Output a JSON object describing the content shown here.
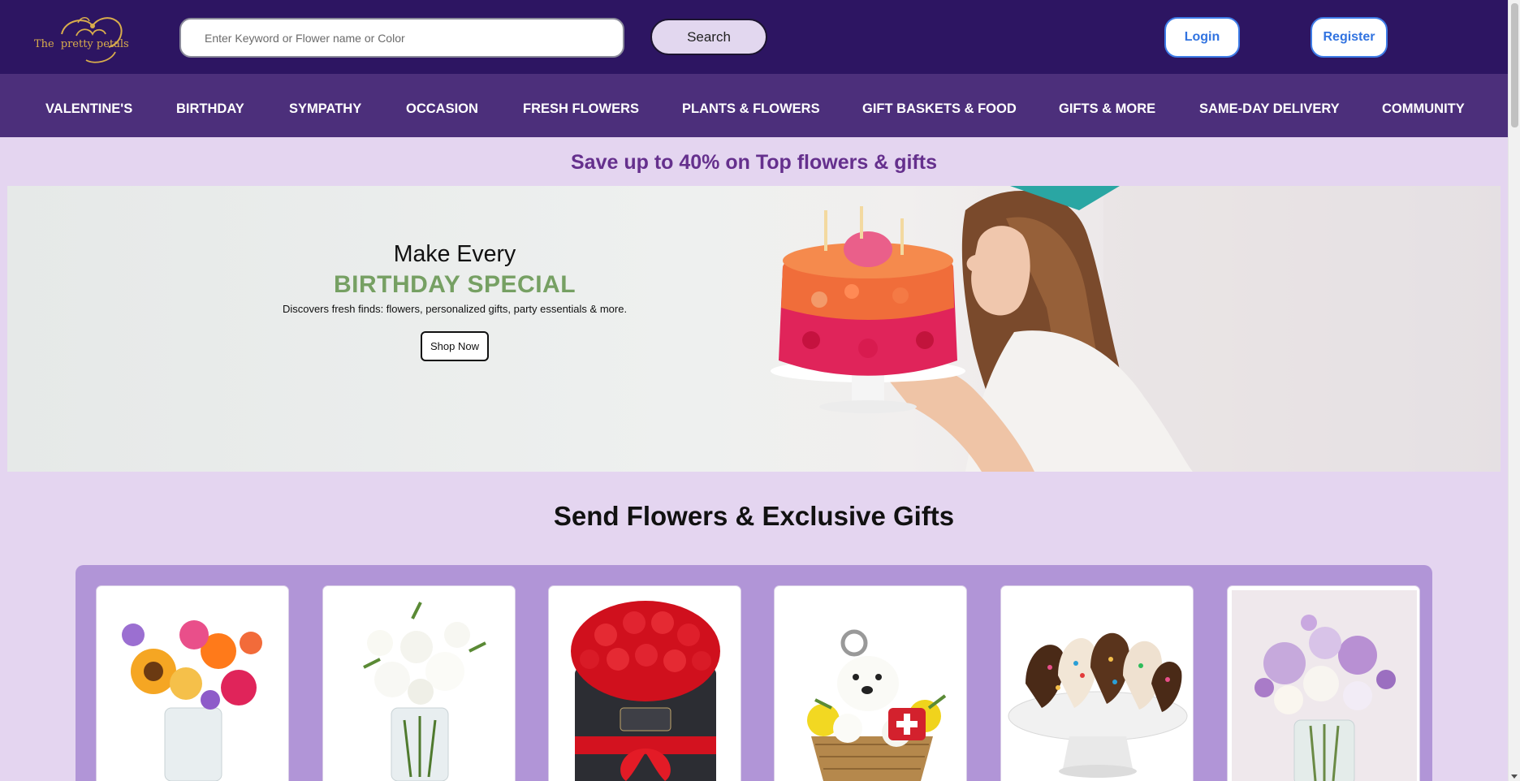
{
  "header": {
    "logo_text": [
      "The",
      "pretty petals"
    ],
    "search_placeholder": "Enter Keyword or Flower name or Color",
    "search_button": "Search",
    "login_button": "Login",
    "register_button": "Register"
  },
  "nav": {
    "items": [
      "VALENTINE'S",
      "BIRTHDAY",
      "SYMPATHY",
      "OCCASION",
      "FRESH FLOWERS",
      "PLANTS & FLOWERS",
      "GIFT BASKETS & FOOD",
      "GIFTS & MORE",
      "SAME-DAY DELIVERY",
      "COMMUNITY"
    ]
  },
  "promo": {
    "text": "Save up to 40% on Top flowers & gifts"
  },
  "hero": {
    "line1": "Make Every",
    "line2": "BIRTHDAY SPECIAL",
    "description": "Discovers fresh finds: flowers, personalized gifts, party essentials & more.",
    "cta": "Shop Now"
  },
  "section": {
    "title": "Send Flowers & Exclusive Gifts"
  },
  "products": [
    {
      "image": "mixed-bouquet-sunflowers-roses"
    },
    {
      "image": "white-lilies-roses-vase"
    },
    {
      "image": "red-roses-hat-box"
    },
    {
      "image": "get-well-puppy-flower-basket"
    },
    {
      "image": "chocolate-dipped-strawberries"
    },
    {
      "image": "lavender-white-roses-vase"
    }
  ],
  "colors": {
    "header_bg": "#2d1562",
    "nav_bg": "#4c2f7b",
    "page_bg": "#e4d5f0",
    "promo_text": "#65308d",
    "accent_green": "#76a063",
    "panel_bg": "#b195d7",
    "auth_blue": "#3173e0"
  }
}
